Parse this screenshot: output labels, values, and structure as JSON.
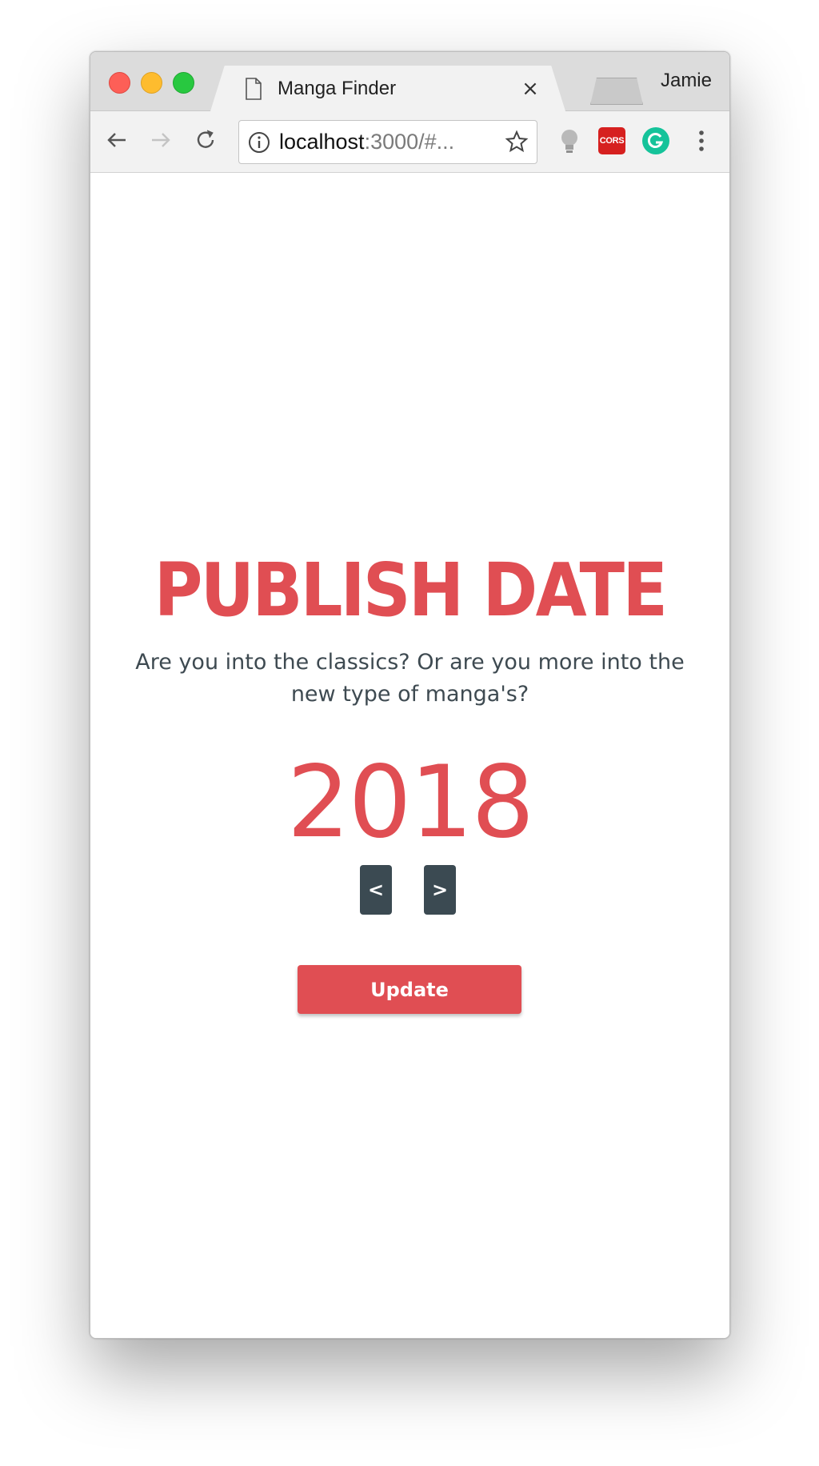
{
  "browser": {
    "tab": {
      "title": "Manga Finder",
      "close_glyph": "×",
      "icon": "document-icon"
    },
    "profile_name": "Jamie",
    "address": {
      "host": "localhost",
      "rest": ":3000/#..."
    },
    "extensions": {
      "cors_label": "CORS"
    }
  },
  "page": {
    "heading": "PUBLISH DATE",
    "description": "Are you into the classics? Or are you more into the new type of manga's?",
    "year": "2018",
    "prev_label": "<",
    "next_label": ">",
    "update_label": "Update"
  },
  "colors": {
    "accent": "#e04e53",
    "stepper_bg": "#3b4a52",
    "text": "#3e4a51"
  }
}
